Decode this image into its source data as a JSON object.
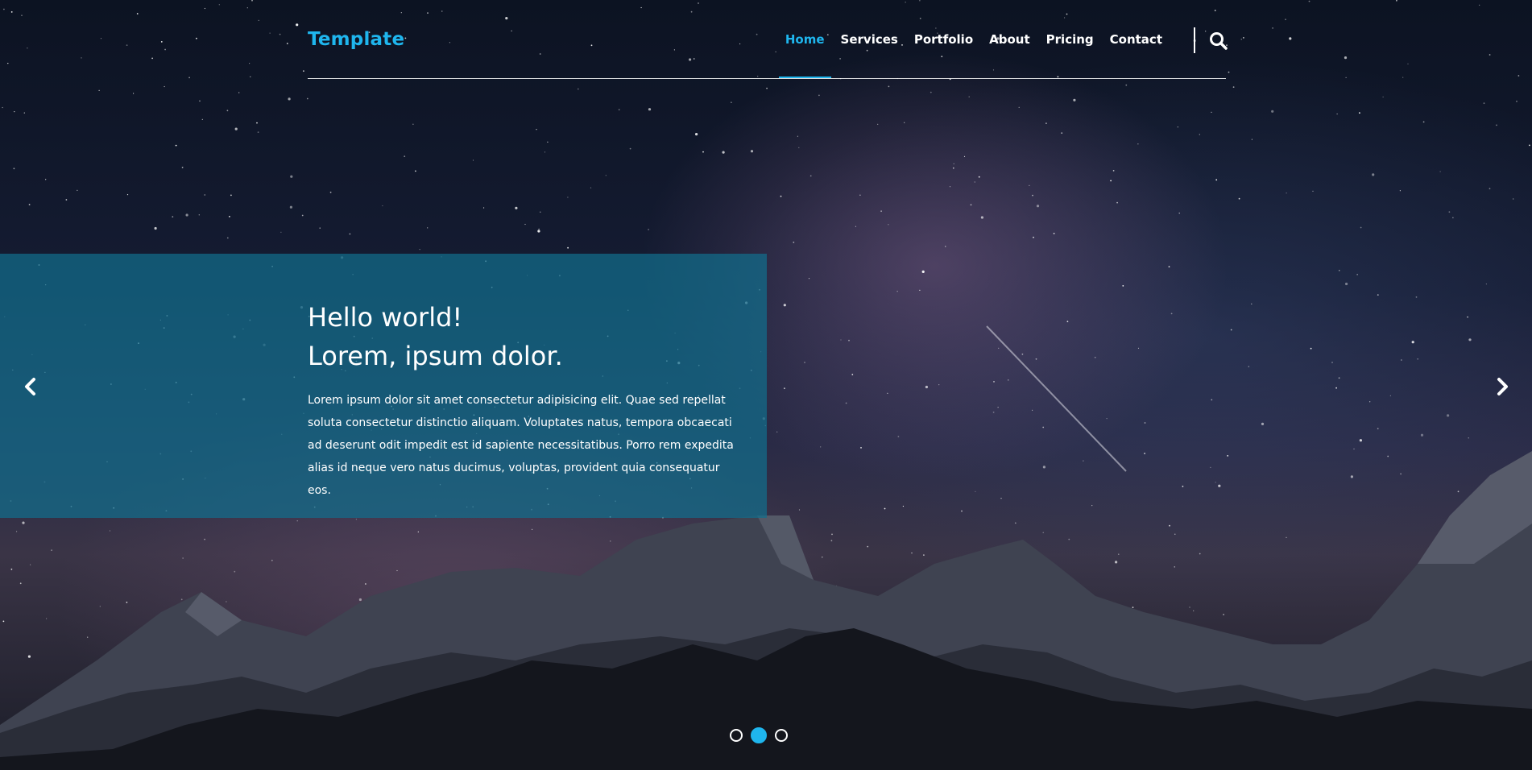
{
  "brand": {
    "name": "Template"
  },
  "nav": {
    "items": [
      {
        "label": "Home",
        "active": true
      },
      {
        "label": "Services",
        "active": false
      },
      {
        "label": "Portfolio",
        "active": false
      },
      {
        "label": "About",
        "active": false
      },
      {
        "label": "Pricing",
        "active": false
      },
      {
        "label": "Contact",
        "active": false
      }
    ],
    "search_icon": "search-icon"
  },
  "hero": {
    "title_line1": "Hello world!",
    "title_line2": "Lorem, ipsum dolor.",
    "text": "Lorem ipsum dolor sit amet consectetur adipisicing elit. Quae sed repellat soluta consectetur distinctio aliquam. Voluptates natus, tempora obcaecati ad deserunt odit impedit est id sapiente necessitatibus. Porro rem expedita alias id neque vero natus ducimus, voluptas, provident quia consequatur eos."
  },
  "carousel": {
    "prev_icon": "chevron-left-icon",
    "next_icon": "chevron-right-icon",
    "slide_count": 3,
    "active_slide": 2
  },
  "colors": {
    "accent": "#1fb6ee",
    "panel": "#126e8c",
    "text": "#ffffff"
  }
}
